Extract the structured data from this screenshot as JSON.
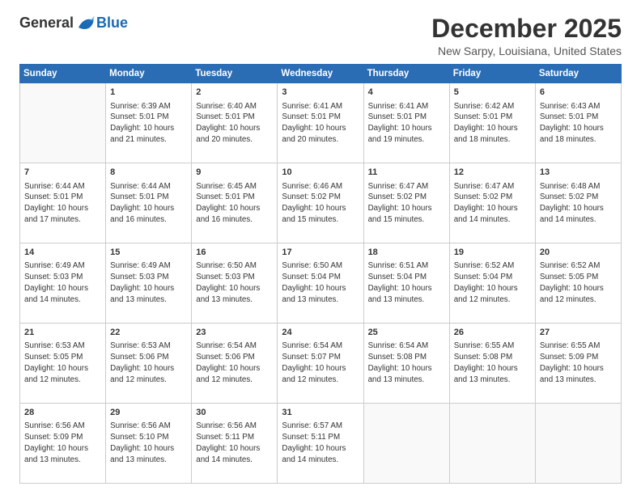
{
  "logo": {
    "general": "General",
    "blue": "Blue"
  },
  "title": "December 2025",
  "location": "New Sarpy, Louisiana, United States",
  "days_of_week": [
    "Sunday",
    "Monday",
    "Tuesday",
    "Wednesday",
    "Thursday",
    "Friday",
    "Saturday"
  ],
  "weeks": [
    [
      {
        "day": "",
        "sunrise": "",
        "sunset": "",
        "daylight": ""
      },
      {
        "day": "1",
        "sunrise": "Sunrise: 6:39 AM",
        "sunset": "Sunset: 5:01 PM",
        "daylight": "Daylight: 10 hours and 21 minutes."
      },
      {
        "day": "2",
        "sunrise": "Sunrise: 6:40 AM",
        "sunset": "Sunset: 5:01 PM",
        "daylight": "Daylight: 10 hours and 20 minutes."
      },
      {
        "day": "3",
        "sunrise": "Sunrise: 6:41 AM",
        "sunset": "Sunset: 5:01 PM",
        "daylight": "Daylight: 10 hours and 20 minutes."
      },
      {
        "day": "4",
        "sunrise": "Sunrise: 6:41 AM",
        "sunset": "Sunset: 5:01 PM",
        "daylight": "Daylight: 10 hours and 19 minutes."
      },
      {
        "day": "5",
        "sunrise": "Sunrise: 6:42 AM",
        "sunset": "Sunset: 5:01 PM",
        "daylight": "Daylight: 10 hours and 18 minutes."
      },
      {
        "day": "6",
        "sunrise": "Sunrise: 6:43 AM",
        "sunset": "Sunset: 5:01 PM",
        "daylight": "Daylight: 10 hours and 18 minutes."
      }
    ],
    [
      {
        "day": "7",
        "sunrise": "Sunrise: 6:44 AM",
        "sunset": "Sunset: 5:01 PM",
        "daylight": "Daylight: 10 hours and 17 minutes."
      },
      {
        "day": "8",
        "sunrise": "Sunrise: 6:44 AM",
        "sunset": "Sunset: 5:01 PM",
        "daylight": "Daylight: 10 hours and 16 minutes."
      },
      {
        "day": "9",
        "sunrise": "Sunrise: 6:45 AM",
        "sunset": "Sunset: 5:01 PM",
        "daylight": "Daylight: 10 hours and 16 minutes."
      },
      {
        "day": "10",
        "sunrise": "Sunrise: 6:46 AM",
        "sunset": "Sunset: 5:02 PM",
        "daylight": "Daylight: 10 hours and 15 minutes."
      },
      {
        "day": "11",
        "sunrise": "Sunrise: 6:47 AM",
        "sunset": "Sunset: 5:02 PM",
        "daylight": "Daylight: 10 hours and 15 minutes."
      },
      {
        "day": "12",
        "sunrise": "Sunrise: 6:47 AM",
        "sunset": "Sunset: 5:02 PM",
        "daylight": "Daylight: 10 hours and 14 minutes."
      },
      {
        "day": "13",
        "sunrise": "Sunrise: 6:48 AM",
        "sunset": "Sunset: 5:02 PM",
        "daylight": "Daylight: 10 hours and 14 minutes."
      }
    ],
    [
      {
        "day": "14",
        "sunrise": "Sunrise: 6:49 AM",
        "sunset": "Sunset: 5:03 PM",
        "daylight": "Daylight: 10 hours and 14 minutes."
      },
      {
        "day": "15",
        "sunrise": "Sunrise: 6:49 AM",
        "sunset": "Sunset: 5:03 PM",
        "daylight": "Daylight: 10 hours and 13 minutes."
      },
      {
        "day": "16",
        "sunrise": "Sunrise: 6:50 AM",
        "sunset": "Sunset: 5:03 PM",
        "daylight": "Daylight: 10 hours and 13 minutes."
      },
      {
        "day": "17",
        "sunrise": "Sunrise: 6:50 AM",
        "sunset": "Sunset: 5:04 PM",
        "daylight": "Daylight: 10 hours and 13 minutes."
      },
      {
        "day": "18",
        "sunrise": "Sunrise: 6:51 AM",
        "sunset": "Sunset: 5:04 PM",
        "daylight": "Daylight: 10 hours and 13 minutes."
      },
      {
        "day": "19",
        "sunrise": "Sunrise: 6:52 AM",
        "sunset": "Sunset: 5:04 PM",
        "daylight": "Daylight: 10 hours and 12 minutes."
      },
      {
        "day": "20",
        "sunrise": "Sunrise: 6:52 AM",
        "sunset": "Sunset: 5:05 PM",
        "daylight": "Daylight: 10 hours and 12 minutes."
      }
    ],
    [
      {
        "day": "21",
        "sunrise": "Sunrise: 6:53 AM",
        "sunset": "Sunset: 5:05 PM",
        "daylight": "Daylight: 10 hours and 12 minutes."
      },
      {
        "day": "22",
        "sunrise": "Sunrise: 6:53 AM",
        "sunset": "Sunset: 5:06 PM",
        "daylight": "Daylight: 10 hours and 12 minutes."
      },
      {
        "day": "23",
        "sunrise": "Sunrise: 6:54 AM",
        "sunset": "Sunset: 5:06 PM",
        "daylight": "Daylight: 10 hours and 12 minutes."
      },
      {
        "day": "24",
        "sunrise": "Sunrise: 6:54 AM",
        "sunset": "Sunset: 5:07 PM",
        "daylight": "Daylight: 10 hours and 12 minutes."
      },
      {
        "day": "25",
        "sunrise": "Sunrise: 6:54 AM",
        "sunset": "Sunset: 5:08 PM",
        "daylight": "Daylight: 10 hours and 13 minutes."
      },
      {
        "day": "26",
        "sunrise": "Sunrise: 6:55 AM",
        "sunset": "Sunset: 5:08 PM",
        "daylight": "Daylight: 10 hours and 13 minutes."
      },
      {
        "day": "27",
        "sunrise": "Sunrise: 6:55 AM",
        "sunset": "Sunset: 5:09 PM",
        "daylight": "Daylight: 10 hours and 13 minutes."
      }
    ],
    [
      {
        "day": "28",
        "sunrise": "Sunrise: 6:56 AM",
        "sunset": "Sunset: 5:09 PM",
        "daylight": "Daylight: 10 hours and 13 minutes."
      },
      {
        "day": "29",
        "sunrise": "Sunrise: 6:56 AM",
        "sunset": "Sunset: 5:10 PM",
        "daylight": "Daylight: 10 hours and 13 minutes."
      },
      {
        "day": "30",
        "sunrise": "Sunrise: 6:56 AM",
        "sunset": "Sunset: 5:11 PM",
        "daylight": "Daylight: 10 hours and 14 minutes."
      },
      {
        "day": "31",
        "sunrise": "Sunrise: 6:57 AM",
        "sunset": "Sunset: 5:11 PM",
        "daylight": "Daylight: 10 hours and 14 minutes."
      },
      {
        "day": "",
        "sunrise": "",
        "sunset": "",
        "daylight": ""
      },
      {
        "day": "",
        "sunrise": "",
        "sunset": "",
        "daylight": ""
      },
      {
        "day": "",
        "sunrise": "",
        "sunset": "",
        "daylight": ""
      }
    ]
  ]
}
